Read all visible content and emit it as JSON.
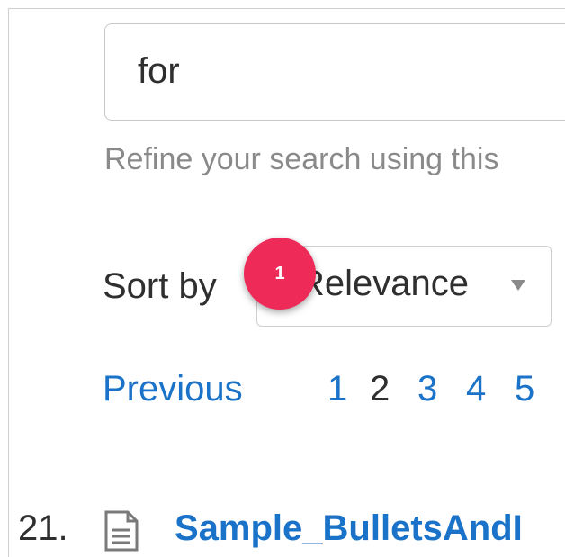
{
  "search": {
    "value": "for"
  },
  "help_text": "Refine your search using this",
  "sort": {
    "label": "Sort by",
    "selected": "Relevance"
  },
  "marker": {
    "label": "1",
    "color": "#ee2a59"
  },
  "pagination": {
    "previous": "Previous",
    "pages": [
      "1",
      "2",
      "3",
      "4",
      "5"
    ],
    "current": "2"
  },
  "result": {
    "number": "21.",
    "title": "Sample_BulletsAndI",
    "icon": "document-icon"
  },
  "colors": {
    "link": "#1a73c8",
    "text": "#2f2f2f",
    "muted": "#8a8a8a"
  }
}
